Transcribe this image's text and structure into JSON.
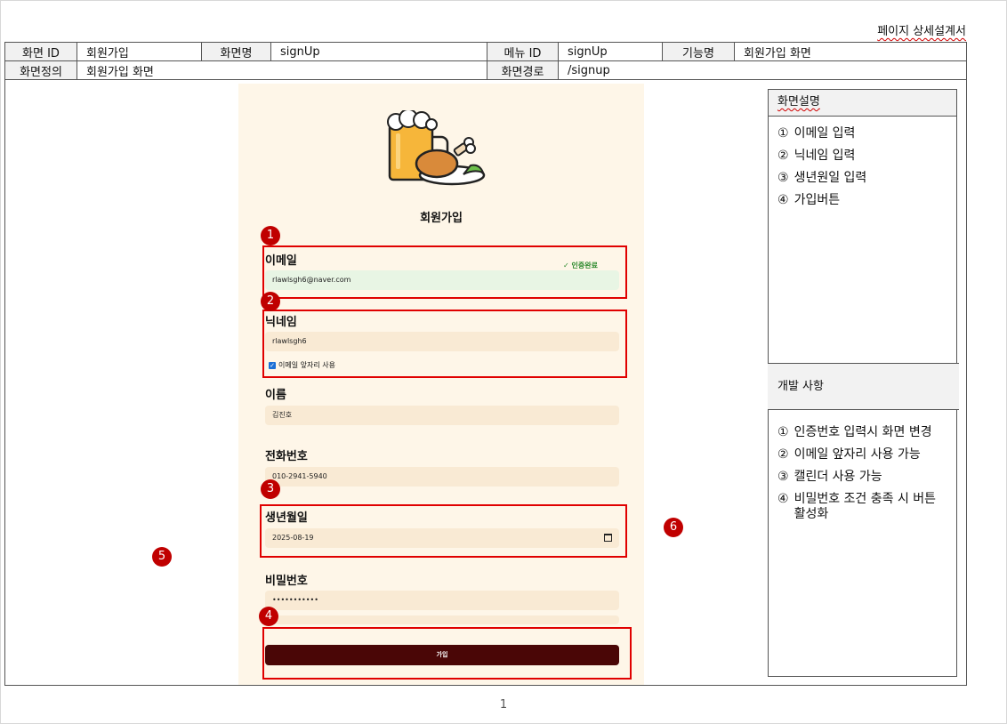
{
  "doc": {
    "title": "페이지 상세설계서",
    "page_number": "1"
  },
  "header": {
    "screen_id_label": "화면 ID",
    "screen_id": "회원가입",
    "screen_name_label": "화면명",
    "screen_name": "signUp",
    "menu_id_label": "메뉴 ID",
    "menu_id": "signUp",
    "function_label": "기능명",
    "function_name": "회원가입 화면",
    "definition_label": "화면정의",
    "definition": "회원가입 화면",
    "path_label": "화면경로",
    "path": "/signup"
  },
  "mockup": {
    "title": "회원가입",
    "email": {
      "label": "이메일",
      "value": "rlawlsgh6@naver.com",
      "status": "✓ 인증완료"
    },
    "nickname": {
      "label": "닉네임",
      "value": "rlawlsgh6",
      "checkbox_label": "이메일 앞자리 사용",
      "checked": true
    },
    "name": {
      "label": "이름",
      "value": "김진호"
    },
    "phone": {
      "label": "전화번호",
      "value": "010-2941-5940"
    },
    "birth": {
      "label": "생년월일",
      "value": "2025-08-19"
    },
    "password": {
      "label": "비밀번호",
      "value": "•••••••••••"
    },
    "submit_label": "가입"
  },
  "markers": [
    "1",
    "2",
    "3",
    "4",
    "5",
    "6"
  ],
  "panel": {
    "description_title": "화면설명",
    "description_items": [
      {
        "num": "①",
        "text": "이메일 입력"
      },
      {
        "num": "②",
        "text": "닉네임 입력"
      },
      {
        "num": "③",
        "text": "생년원일 입력"
      },
      {
        "num": "④",
        "text": "가입버튼"
      }
    ],
    "dev_title": "개발 사항",
    "dev_items": [
      {
        "num": "①",
        "text": "인증번호 입력시 화면 변경"
      },
      {
        "num": "②",
        "text": "이메일 앞자리 사용 가능"
      },
      {
        "num": "③",
        "text": "캘린더 사용 가능"
      },
      {
        "num": "④",
        "text": "비밀번호 조건 충족 시 버튼 활성화"
      }
    ]
  },
  "colors": {
    "highlight": "#e00000",
    "marker": "#c00000",
    "mock_bg": "#fef6e8",
    "button": "#4a0606"
  }
}
